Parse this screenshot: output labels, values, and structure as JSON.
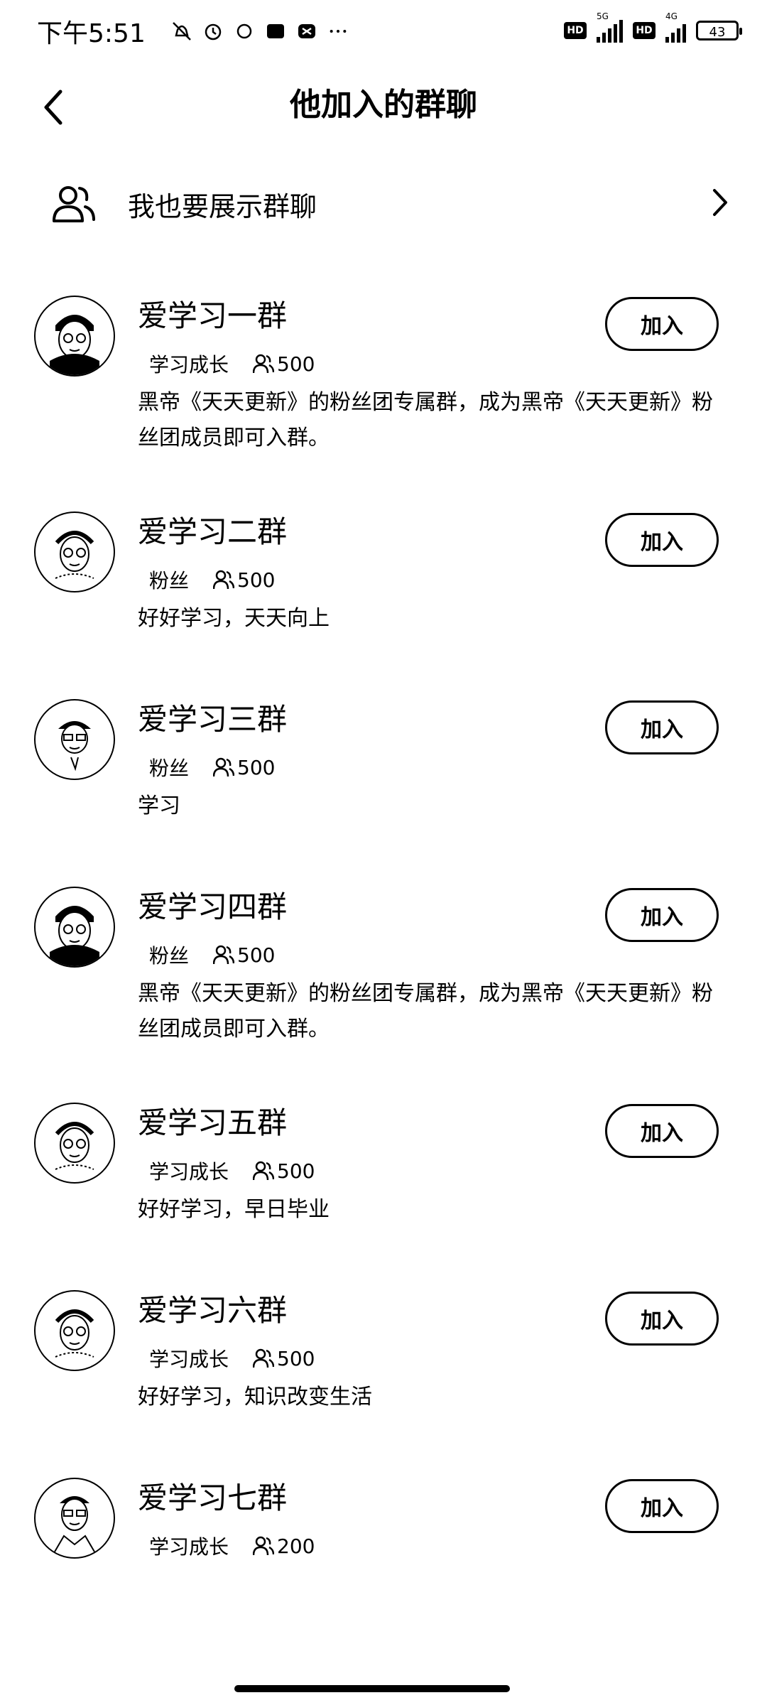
{
  "status_bar": {
    "time": "下午5:51",
    "network_5g": "5G",
    "network_4g": "4G",
    "hd": "HD",
    "battery": "43"
  },
  "header": {
    "title": "他加入的群聊"
  },
  "show_group": {
    "label": "我也要展示群聊"
  },
  "join_label": "加入",
  "groups": [
    {
      "name": "爱学习一群",
      "tag": "学习成长",
      "count": "500",
      "description": "黑帝《天天更新》的粉丝团专属群，成为黑帝《天天更新》粉丝团成员即可入群。"
    },
    {
      "name": "爱学习二群",
      "tag": "粉丝",
      "count": "500",
      "description": "好好学习，天天向上"
    },
    {
      "name": "爱学习三群",
      "tag": "粉丝",
      "count": "500",
      "description": "学习"
    },
    {
      "name": "爱学习四群",
      "tag": "粉丝",
      "count": "500",
      "description": "黑帝《天天更新》的粉丝团专属群，成为黑帝《天天更新》粉丝团成员即可入群。"
    },
    {
      "name": "爱学习五群",
      "tag": "学习成长",
      "count": "500",
      "description": "好好学习，早日毕业"
    },
    {
      "name": "爱学习六群",
      "tag": "学习成长",
      "count": "500",
      "description": "好好学习，知识改变生活"
    },
    {
      "name": "爱学习七群",
      "tag": "学习成长",
      "count": "200",
      "description": ""
    }
  ]
}
